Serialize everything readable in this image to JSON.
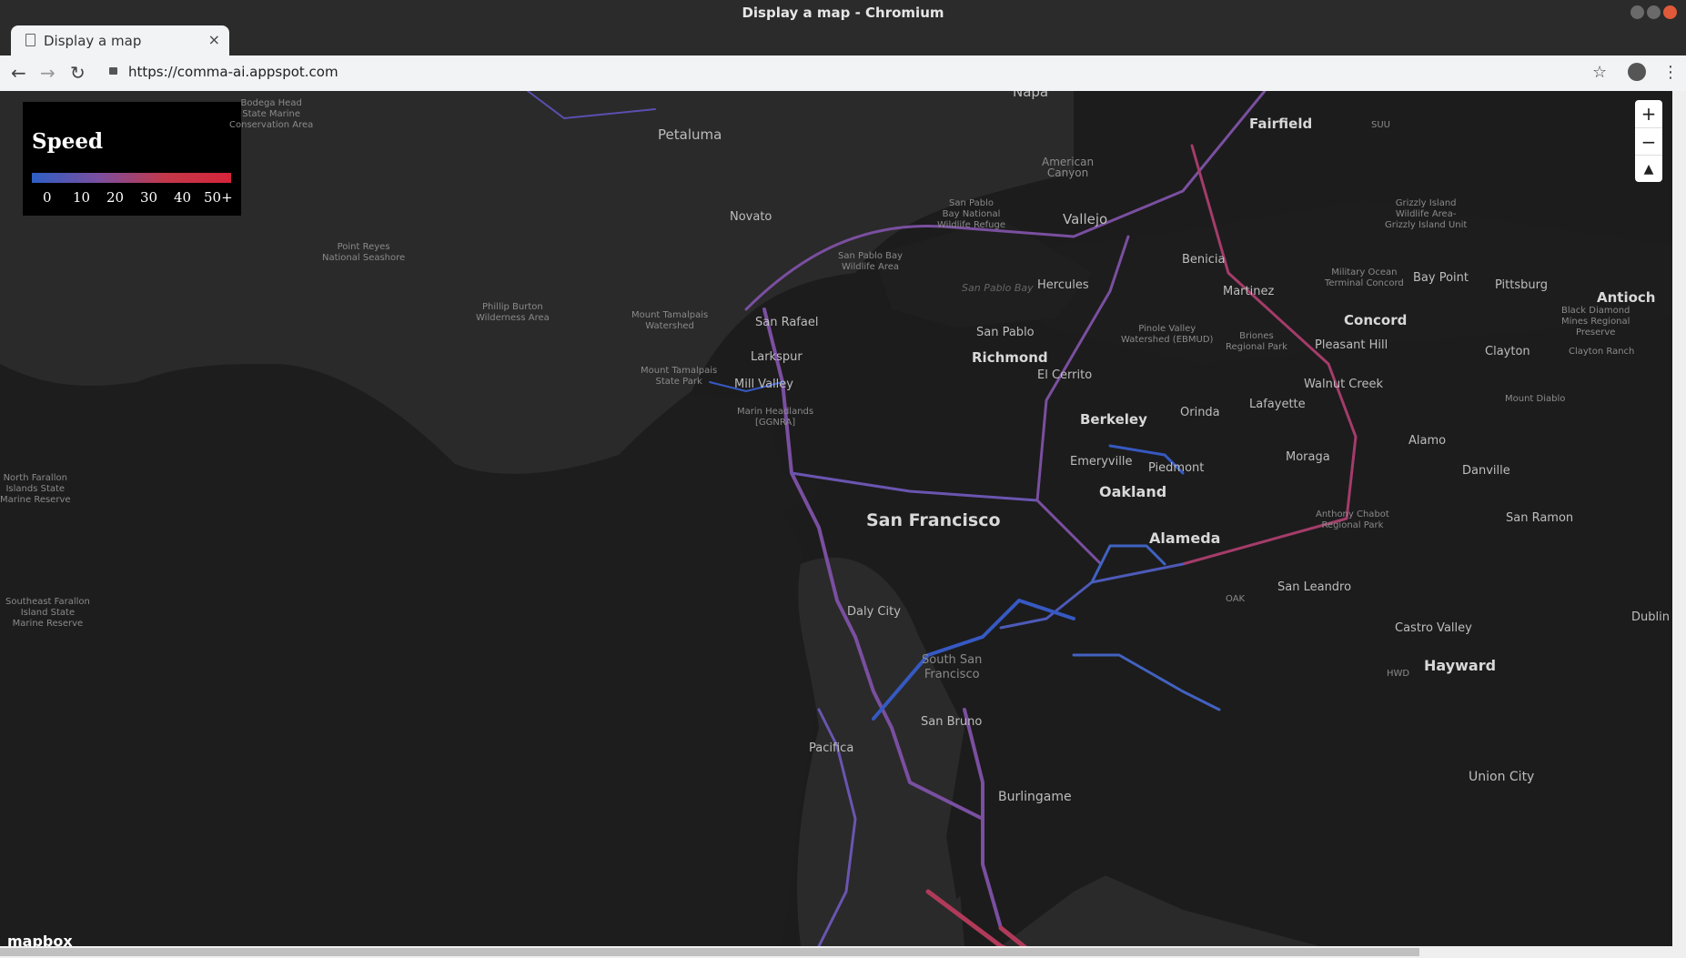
{
  "window": {
    "title": "Display a map - Chromium"
  },
  "tab": {
    "label": "Display a map",
    "close": "×",
    "new_tab": "+"
  },
  "toolbar": {
    "back": "←",
    "forward": "→",
    "reload": "↻",
    "url": "https://comma-ai.appspot.com",
    "star": "☆",
    "menu": "⋮"
  },
  "legend": {
    "title": "Speed",
    "ticks": [
      "0",
      "10",
      "20",
      "30",
      "40",
      "50+"
    ],
    "gradient_colors": [
      "#2d5fc4",
      "#7a4fa0",
      "#c2384a",
      "#d6243a"
    ]
  },
  "zoom": {
    "in": "+",
    "out": "−",
    "compass": "▲"
  },
  "attribution": "mapbox",
  "map_labels": {
    "napa": "Napa",
    "fairfield": "Fairfield",
    "suu": "SUU",
    "petaluma": "Petaluma",
    "american_canyon": "American\nCanyon",
    "vallejo": "Vallejo",
    "san_pablo_bay_nwr": "San Pablo\nBay National\nWildlife Refuge",
    "grizzly_island": "Grizzly Island\nWildlife Area-\nGrizzly Island Unit",
    "novato": "Novato",
    "sp_bay_wildlife": "San Pablo Bay\nWildlife Area",
    "point_reyes": "Point Reyes\nNational Seashore",
    "benicia": "Benicia",
    "military_ocean": "Military Ocean\nTerminal Concord",
    "bay_point": "Bay Point",
    "pittsburg": "Pittsburg",
    "antioch": "Antioch",
    "san_pablo_bay": "San Pablo Bay",
    "hercules": "Hercules",
    "martinez": "Martinez",
    "concord": "Concord",
    "bodega_head": "Bodega Head\nState Marine\nConservation Area",
    "phillip_burton": "Phillip Burton\nWilderness Area",
    "mount_tamalpais_ws": "Mount Tamalpais\nWatershed",
    "san_rafael": "San Rafael",
    "san_pablo": "San Pablo",
    "pinole_valley": "Pinole Valley\nWatershed (EBMUD)",
    "briones": "Briones\nRegional Park",
    "pleasant_hill": "Pleasant Hill",
    "black_diamond": "Black Diamond\nMines Regional\nPreserve",
    "clayton": "Clayton",
    "clayton_ranch": "Clayton Ranch",
    "larkspur": "Larkspur",
    "richmond": "Richmond",
    "mill_valley": "Mill Valley",
    "mount_tamalpais_sp": "Mount Tamalpais\nState Park",
    "el_cerrito": "El Cerrito",
    "walnut_creek": "Walnut Creek",
    "lafayette": "Lafayette",
    "orinda": "Orinda",
    "berkeley": "Berkeley",
    "mount_diablo": "Mount Diablo",
    "marin_headlands": "Marin Headlands\n[GGNRA]",
    "alamo": "Alamo",
    "moraga": "Moraga",
    "emeryville": "Emeryville",
    "piedmont": "Piedmont",
    "danville": "Danville",
    "oakland": "Oakland",
    "north_farallon": "North Farallon\nIslands State\nMarine Reserve",
    "san_francisco": "San Francisco",
    "san_ramon": "San Ramon",
    "alameda": "Alameda",
    "anthony_chabot": "Anthony Chabot\nRegional Park",
    "san_leandro": "San Leandro",
    "oak": "OAK",
    "daly_city": "Daly City",
    "dublin": "Dublin",
    "castro_valley": "Castro Valley",
    "southeast_farallon": "Southeast Farallon\nIsland State\nMarine Reserve",
    "hayward": "Hayward",
    "south_sf": "South San\nFrancisco",
    "hwd": "HWD",
    "san_bruno": "San Bruno",
    "pacifica": "Pacifica",
    "union_city": "Union City",
    "burlingame": "Burlingame"
  },
  "colors": {
    "map_bg": "#1c1c1c",
    "land": "#2a2a2a",
    "water": "#1c1c1c",
    "route_slow": "#2d5fc4",
    "route_mid": "#7a4fa0",
    "route_fast": "#b03a5a"
  }
}
